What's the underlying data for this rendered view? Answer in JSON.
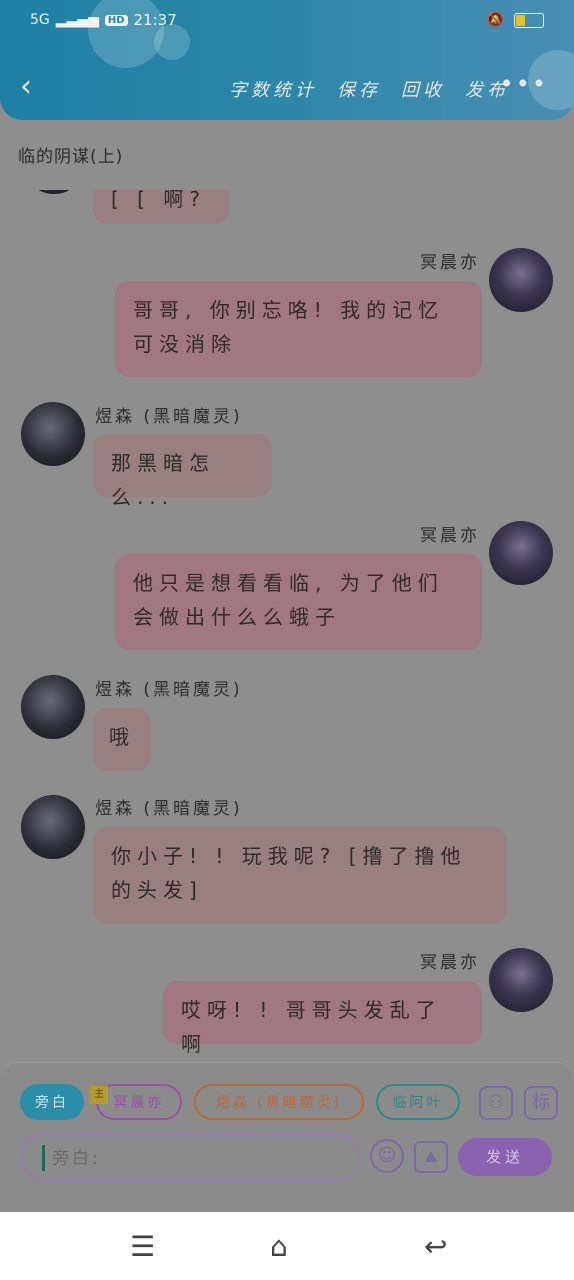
{
  "status_bar": {
    "network": "5G",
    "hd": "HD",
    "time": "21:37"
  },
  "header": {
    "back_icon": "chevron-left-icon",
    "actions": [
      "字数统计",
      "保存",
      "回收",
      "发布"
    ],
    "more": "•••"
  },
  "chapter_title": "临的阴谋(上)",
  "messages": [
    {
      "side": "left",
      "text": "[ [ 啊?"
    },
    {
      "side": "right",
      "name": "冥晨亦",
      "text": "哥哥, 你别忘咯! 我的记忆可没消除"
    },
    {
      "side": "left",
      "name": "煜森 (黑暗魔灵)",
      "text": "那黑暗怎么..."
    },
    {
      "side": "right",
      "name": "冥晨亦",
      "text": "他只是想看看临, 为了他们会做出什么么蛾子"
    },
    {
      "side": "left",
      "name": "煜森 (黑暗魔灵)",
      "text": "哦"
    },
    {
      "side": "left",
      "name": "煜森 (黑暗魔灵)",
      "text": "你小子! ! 玩我呢? [撸了撸他的头发]"
    },
    {
      "side": "right",
      "name": "冥晨亦",
      "text": "哎呀! ! 哥哥头发乱了啊"
    }
  ],
  "role_chips": [
    "旁白",
    "冥晨亦",
    "煜森 (黑暗魔灵)",
    "临阿叶"
  ],
  "chip_mark": "主",
  "tools": {
    "person_icon": "person-icon",
    "tag_label": "标",
    "emoji_icon": "smile-icon",
    "image_icon": "image-icon"
  },
  "input": {
    "placeholder": "旁白:"
  },
  "send_label": "发送",
  "nav": {
    "menu_icon": "menu-icon",
    "home_icon": "home-icon",
    "back_icon": "back-icon"
  }
}
